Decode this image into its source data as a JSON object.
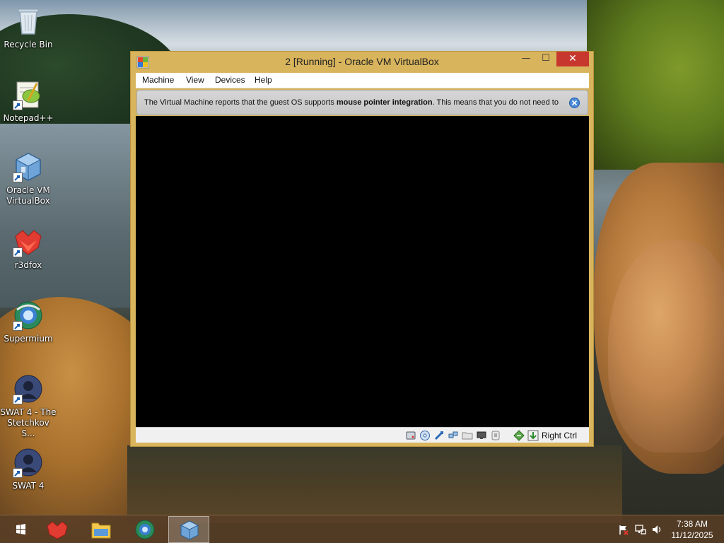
{
  "desktop": {
    "icons": [
      {
        "label": "Recycle Bin",
        "icon": "recycle-bin-icon",
        "shortcut": false
      },
      {
        "label": "Notepad++",
        "icon": "notepad-plus-plus-icon",
        "shortcut": true
      },
      {
        "label": "Oracle VM VirtualBox",
        "icon": "virtualbox-icon",
        "shortcut": true
      },
      {
        "label": "r3dfox",
        "icon": "r3dfox-icon",
        "shortcut": true
      },
      {
        "label": "Supermium",
        "icon": "supermium-icon",
        "shortcut": true
      },
      {
        "label": "SWAT 4 - The Stetchkov S...",
        "icon": "swat4-syndicate-icon",
        "shortcut": true
      },
      {
        "label": "SWAT 4",
        "icon": "swat4-icon",
        "shortcut": true
      }
    ]
  },
  "window": {
    "title": "2 [Running] - Oracle VM VirtualBox",
    "controls": {
      "minimize": "—",
      "maximize": "☐",
      "close": "✕"
    },
    "menu": [
      "Machine",
      "View",
      "Devices",
      "Help"
    ],
    "notice": {
      "prefix": "The Virtual Machine reports that the guest OS supports ",
      "bold": "mouse pointer integration",
      "suffix": ". This means that you do not need to"
    },
    "status_icons": [
      "hard-disk-icon",
      "optical-drive-icon",
      "usb-icon",
      "network-icon",
      "shared-folders-icon",
      "display-icon",
      "recording-icon",
      "mouse-integration-icon",
      "host-key-arrow-icon"
    ],
    "host_key": "Right Ctrl"
  },
  "taskbar": {
    "buttons": [
      "start-button",
      "r3dfox-taskbar",
      "file-explorer-taskbar",
      "supermium-taskbar",
      "virtualbox-taskbar"
    ],
    "tray": [
      "action-center-flag-icon",
      "network-icon",
      "volume-icon"
    ],
    "time": "7:38 AM",
    "date": "11/12/2025"
  },
  "colors": {
    "window_frame": "#d8b45c",
    "close_button": "#c7372e",
    "taskbar": "#583e26"
  }
}
